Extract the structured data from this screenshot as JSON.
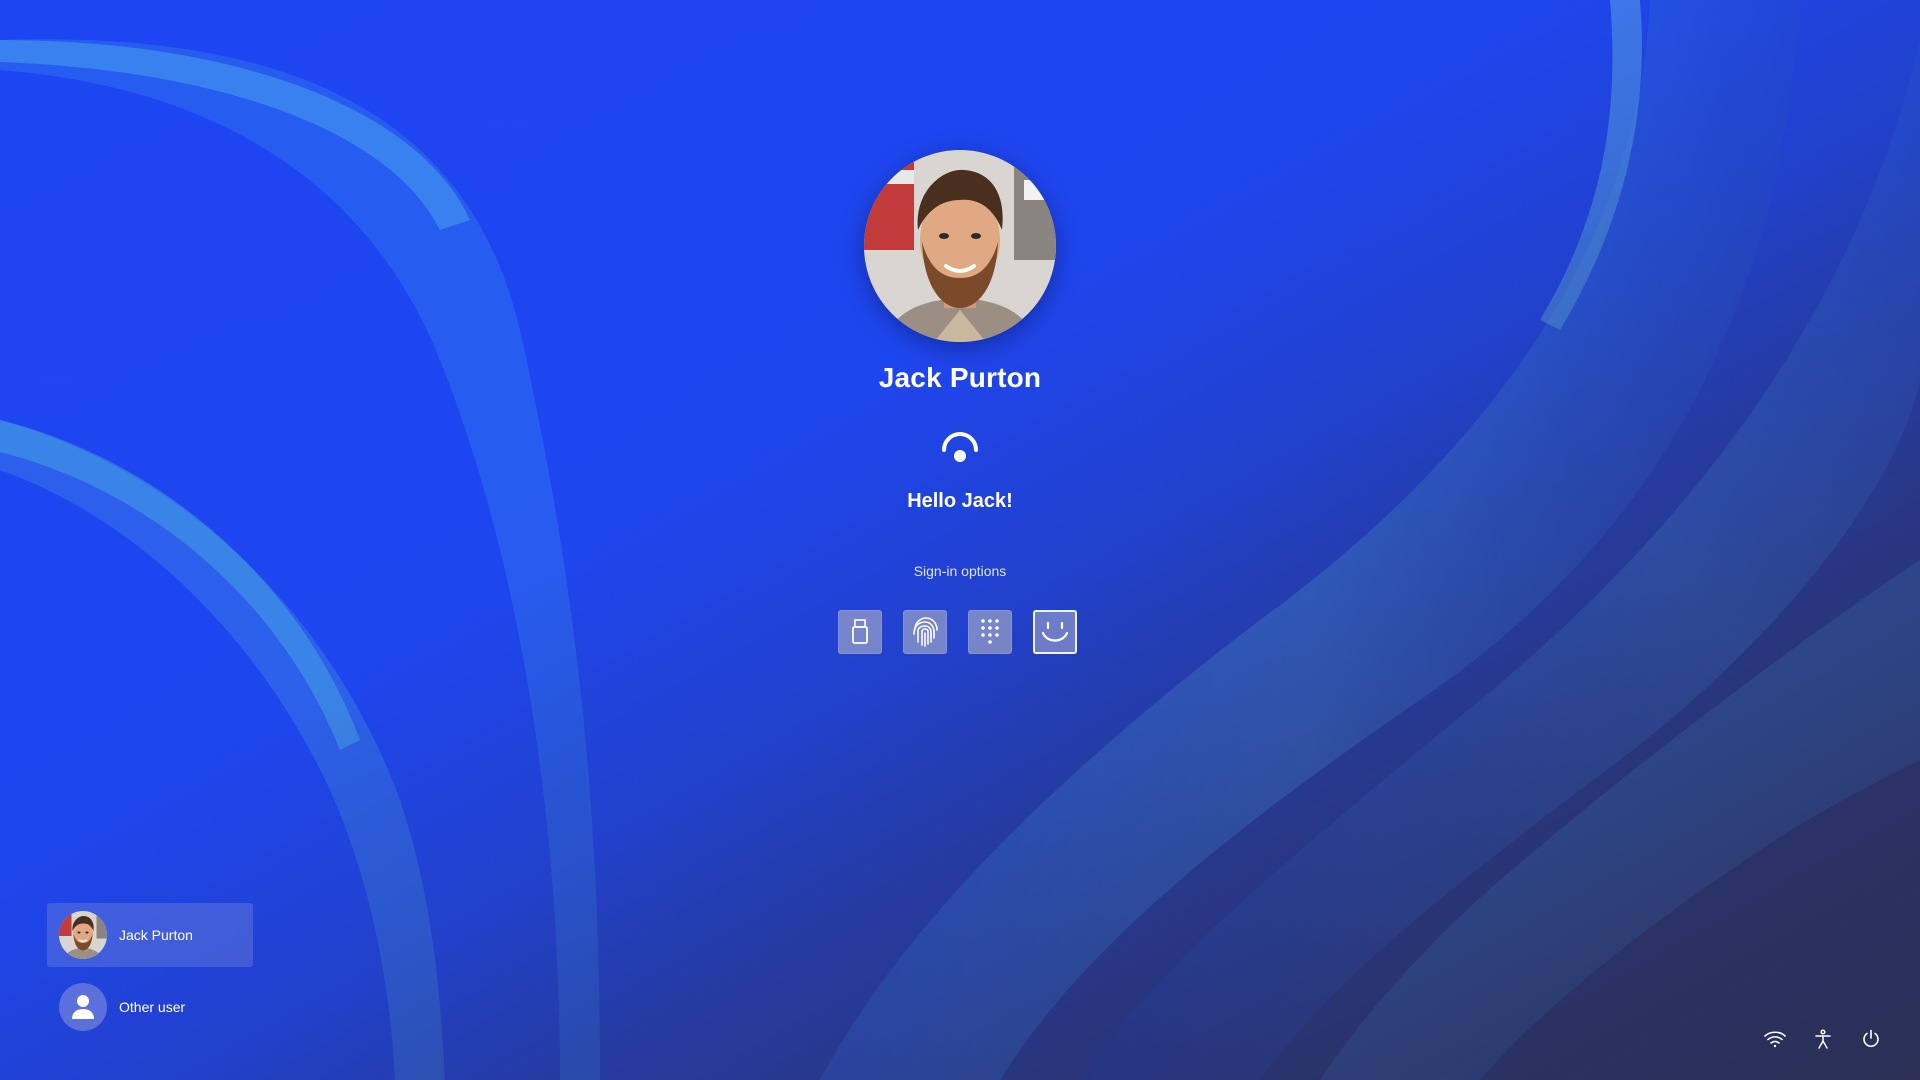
{
  "user": {
    "name": "Jack Purton",
    "greeting": "Hello Jack!"
  },
  "signin": {
    "options_label": "Sign-in options",
    "options": [
      {
        "id": "security-key",
        "icon": "usb-key-icon",
        "selected": false
      },
      {
        "id": "fingerprint",
        "icon": "fingerprint-icon",
        "selected": false
      },
      {
        "id": "pin",
        "icon": "pin-keypad-icon",
        "selected": false
      },
      {
        "id": "facial-recognition",
        "icon": "face-icon",
        "selected": true
      }
    ]
  },
  "user_list": [
    {
      "label": "Jack Purton",
      "active": true
    },
    {
      "label": "Other user",
      "active": false
    }
  ],
  "tray": {
    "items": [
      "wifi-icon",
      "accessibility-icon",
      "power-icon"
    ]
  },
  "colors": {
    "background_blue": "#1f47f0",
    "deep_navy": "#2a2f6a",
    "ribbon_light": "#3f8fe8"
  }
}
